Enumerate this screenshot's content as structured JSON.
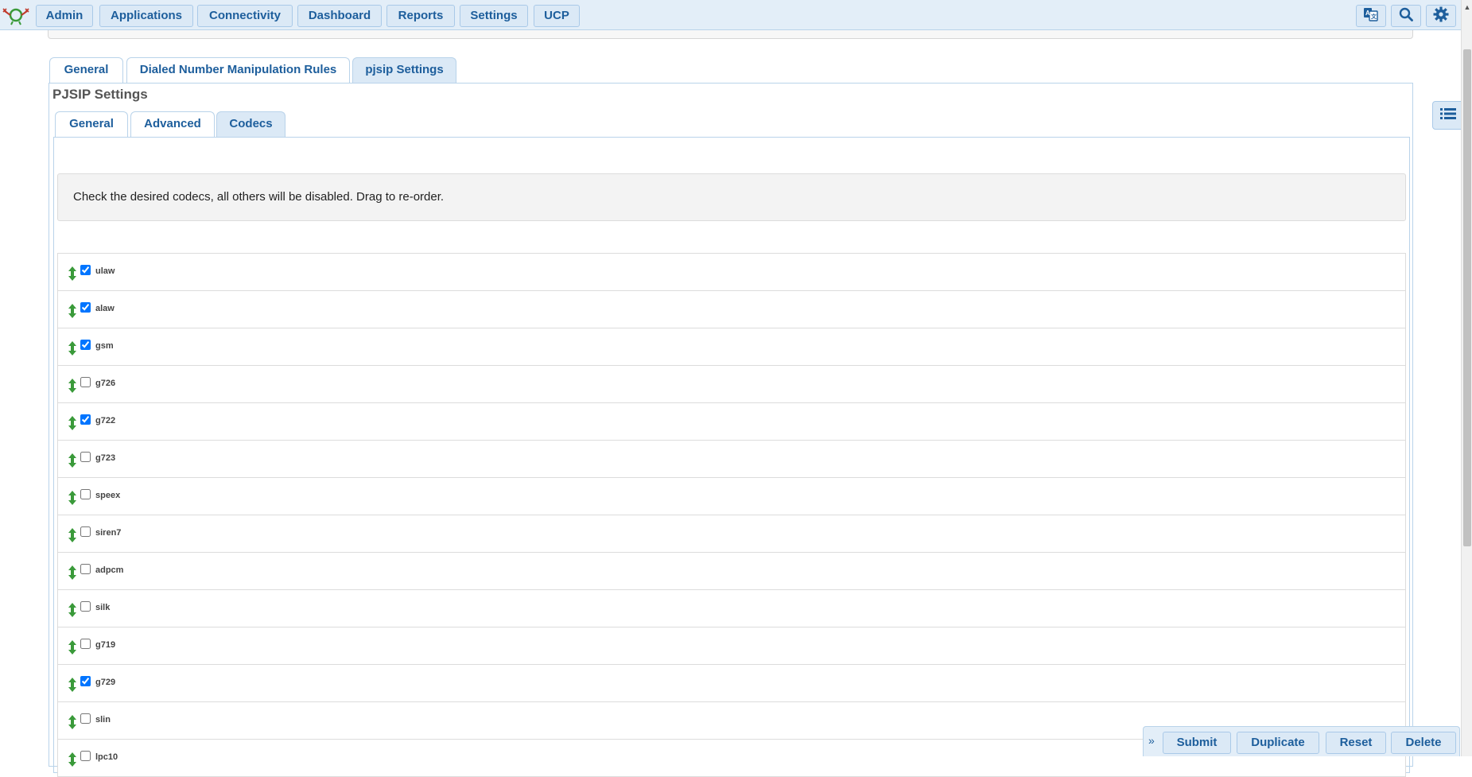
{
  "nav": {
    "items": [
      {
        "label": "Admin"
      },
      {
        "label": "Applications"
      },
      {
        "label": "Connectivity"
      },
      {
        "label": "Dashboard"
      },
      {
        "label": "Reports"
      },
      {
        "label": "Settings"
      },
      {
        "label": "UCP"
      }
    ],
    "icons": [
      "language-icon",
      "search-icon",
      "gear-icon"
    ]
  },
  "outer_tabs": [
    {
      "label": "General",
      "active": false
    },
    {
      "label": "Dialed Number Manipulation Rules",
      "active": false
    },
    {
      "label": "pjsip Settings",
      "active": true
    }
  ],
  "section_title": "PJSIP Settings",
  "inner_tabs": [
    {
      "label": "General",
      "active": false
    },
    {
      "label": "Advanced",
      "active": false
    },
    {
      "label": "Codecs",
      "active": true
    }
  ],
  "help_text": "Check the desired codecs, all others will be disabled. Drag to re-order.",
  "codecs": [
    {
      "name": "ulaw",
      "checked": true
    },
    {
      "name": "alaw",
      "checked": true
    },
    {
      "name": "gsm",
      "checked": true
    },
    {
      "name": "g726",
      "checked": false
    },
    {
      "name": "g722",
      "checked": true
    },
    {
      "name": "g723",
      "checked": false
    },
    {
      "name": "speex",
      "checked": false
    },
    {
      "name": "siren7",
      "checked": false
    },
    {
      "name": "adpcm",
      "checked": false
    },
    {
      "name": "silk",
      "checked": false
    },
    {
      "name": "g719",
      "checked": false
    },
    {
      "name": "g729",
      "checked": true
    },
    {
      "name": "slin",
      "checked": false
    },
    {
      "name": "lpc10",
      "checked": false
    }
  ],
  "actions": {
    "submit": "Submit",
    "duplicate": "Duplicate",
    "reset": "Reset",
    "delete": "Delete"
  },
  "colors": {
    "accent": "#1d5e9c",
    "nav_bg": "#e3eef8",
    "border": "#b9d3ea",
    "drag_handle": "#3a9a3a"
  }
}
